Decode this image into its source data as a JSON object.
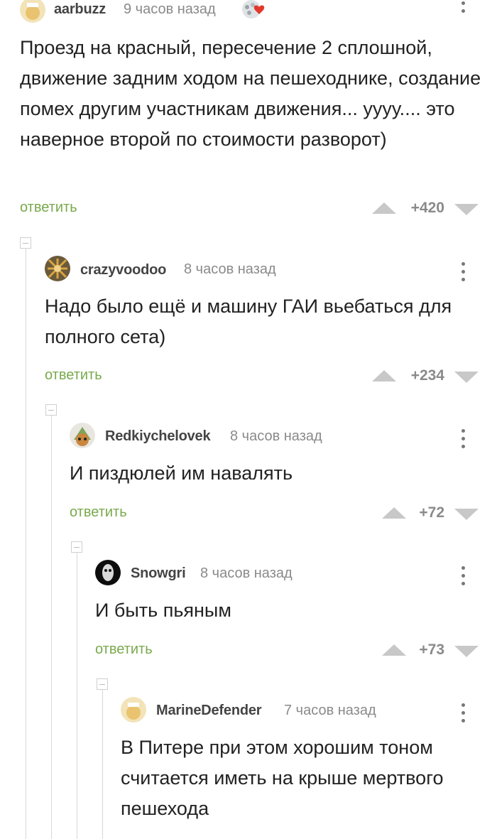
{
  "comments": [
    {
      "user": "aarbuzz",
      "time": "9 часов назад",
      "text": "Проезд на красный, пересечение 2 сплошной, движение задним ходом на пешеходнике, создание помех другим участникам движения... уууу.... это наверное второй по стоимости разворот)",
      "reply": "ответить",
      "score": "+420",
      "has_badge": true
    },
    {
      "user": "crazyvoodoo",
      "time": "8 часов назад",
      "text": "Надо было ещё и машину ГАИ вьебаться для полного сета)",
      "reply": "ответить",
      "score": "+234"
    },
    {
      "user": "Redkiychelovek",
      "time": "8 часов назад",
      "text": "И пиздюлей им навалять",
      "reply": "ответить",
      "score": "+72"
    },
    {
      "user": "Snowgri",
      "time": "8 часов назад",
      "text": "И быть пьяным",
      "reply": "ответить",
      "score": "+73"
    },
    {
      "user": "MarineDefender",
      "time": "7 часов назад",
      "text": "В Питере при этом хорошим тоном считается иметь на крыше мертвого пешехода",
      "reply": "ответить"
    }
  ],
  "colors": {
    "reply_green": "#79a94c",
    "vote_arrow": "#c8c8c8",
    "meta_gray": "#8a8a8a",
    "thread_line": "#d8d8d8"
  },
  "icons": [
    "vote-up-icon",
    "vote-down-icon",
    "more-menu-icon",
    "collapse-thread-icon",
    "heart-badge-icon"
  ]
}
